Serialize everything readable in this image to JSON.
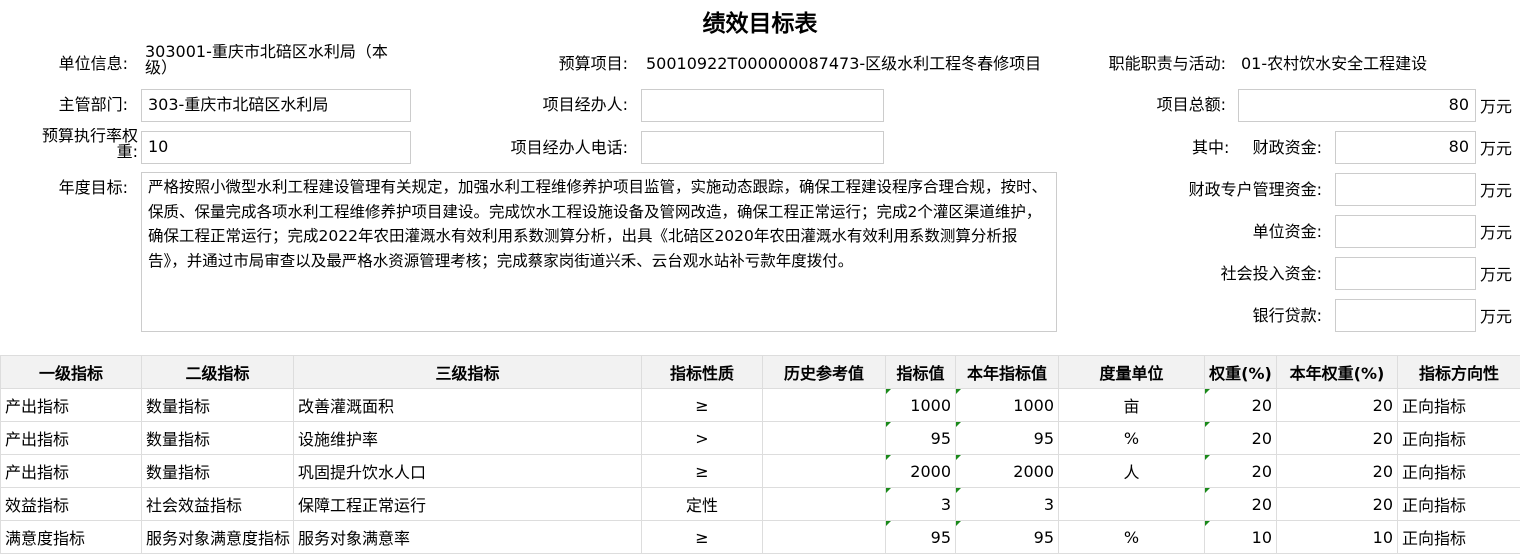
{
  "title": "绩效目标表",
  "header": {
    "unit_label": "单位信息:",
    "unit_value": "303001-重庆市北碚区水利局（本级）",
    "budget_item_label": "预算项目:",
    "budget_item_value": "50010922T000000087473-区级水利工程冬春修项目",
    "duty_label": "职能职责与活动:",
    "duty_value": "01-农村饮水安全工程建设",
    "dept_label": "主管部门:",
    "dept_value": "303-重庆市北碚区水利局",
    "manager_label": "项目经办人:",
    "manager_value": "",
    "total_label": "项目总额:",
    "total_value": "80",
    "rate_label": "预算执行率权重:",
    "rate_value": "10",
    "manager_phone_label": "项目经办人电话:",
    "manager_phone_value": "",
    "among_label": "其中:",
    "fiscal_label": "财政资金:",
    "fiscal_value": "80",
    "special_label": "财政专户管理资金:",
    "special_value": "",
    "own_label": "单位资金:",
    "own_value": "",
    "social_label": "社会投入资金:",
    "social_value": "",
    "loan_label": "银行贷款:",
    "loan_value": "",
    "unit_wan": "万元",
    "goal_label": "年度目标:",
    "goal_text": "严格按照小微型水利工程建设管理有关规定，加强水利工程维修养护项目监管，实施动态跟踪，确保工程建设程序合理合规，按时、保质、保量完成各项水利工程维修养护项目建设。完成饮水工程设施设备及管网改造，确保工程正常运行；完成2个灌区渠道维护，确保工程正常运行；完成2022年农田灌溉水有效利用系数测算分析，出具《北碚区2020年农田灌溉水有效利用系数测算分析报告》，并通过市局审查以及最严格水资源管理考核；完成蔡家岗街道兴禾、云台观水站补亏款年度拨付。"
  },
  "table": {
    "columns": [
      "一级指标",
      "二级指标",
      "三级指标",
      "指标性质",
      "历史参考值",
      "指标值",
      "本年指标值",
      "度量单位",
      "权重(%)",
      "本年权重(%)",
      "指标方向性"
    ],
    "rows": [
      [
        "产出指标",
        "数量指标",
        "改善灌溉面积",
        "≥",
        "",
        "1000",
        "1000",
        "亩",
        "20",
        "20",
        "正向指标"
      ],
      [
        "产出指标",
        "数量指标",
        "设施维护率",
        ">",
        "",
        "95",
        "95",
        "%",
        "20",
        "20",
        "正向指标"
      ],
      [
        "产出指标",
        "数量指标",
        "巩固提升饮水人口",
        "≥",
        "",
        "2000",
        "2000",
        "人",
        "20",
        "20",
        "正向指标"
      ],
      [
        "效益指标",
        "社会效益指标",
        "保障工程正常运行",
        "定性",
        "",
        "3",
        "3",
        "",
        "20",
        "20",
        "正向指标"
      ],
      [
        "满意度指标",
        "服务对象满意度指标",
        "服务对象满意率",
        "≥",
        "",
        "95",
        "95",
        "%",
        "10",
        "10",
        "正向指标"
      ]
    ]
  }
}
